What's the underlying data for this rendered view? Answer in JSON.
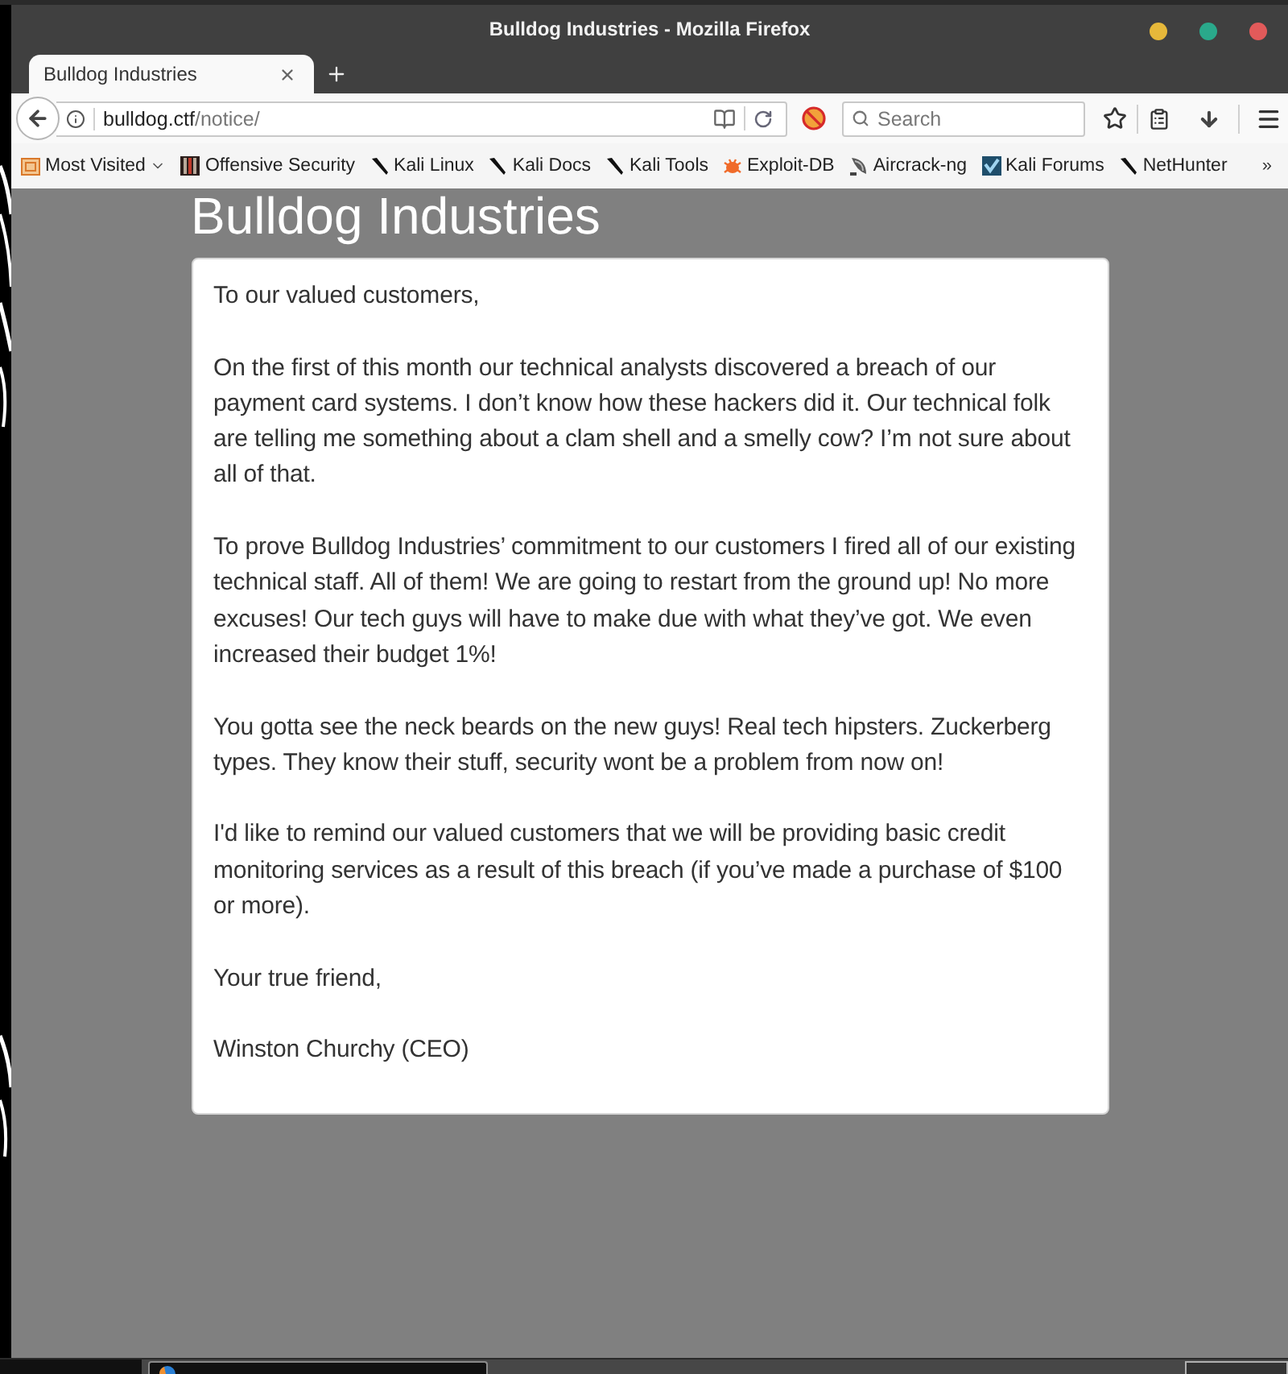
{
  "window": {
    "title": "Bulldog Industries - Mozilla Firefox",
    "controls": [
      {
        "color": "#e6b83a"
      },
      {
        "color": "#2aa98b"
      },
      {
        "color": "#e25a5a"
      }
    ]
  },
  "tabs": [
    {
      "title": "Bulldog Industries",
      "selected": true
    }
  ],
  "toolbar": {
    "url": {
      "host": "bulldog.ctf",
      "path": "/notice/"
    },
    "search": {
      "placeholder": "Search"
    }
  },
  "bookmarks": [
    {
      "kind": "folder",
      "label": "Most Visited"
    },
    {
      "kind": "offsec",
      "label": "Offensive Security"
    },
    {
      "kind": "kali",
      "label": "Kali Linux"
    },
    {
      "kind": "kali",
      "label": "Kali Docs"
    },
    {
      "kind": "kali",
      "label": "Kali Tools"
    },
    {
      "kind": "exploit",
      "label": "Exploit-DB"
    },
    {
      "kind": "aircrack",
      "label": "Aircrack-ng"
    },
    {
      "kind": "forum",
      "label": "Kali Forums"
    },
    {
      "kind": "kali",
      "label": "NetHunter"
    }
  ],
  "bookmarks_overflow": "»",
  "page": {
    "heading": "Bulldog Industries",
    "paragraphs": [
      "To our valued customers,",
      "On the first of this month our technical analysts discovered a breach of our payment card systems. I don’t know how these hackers did it. Our technical folk are telling me something about a clam shell and a smelly cow? I’m not sure about all of that.",
      "To prove Bulldog Industries’ commitment to our customers I fired all of our existing technical staff. All of them! We are going to restart from the ground up! No more excuses! Our tech guys will have to make due with what they’ve got. We even increased their budget 1%!",
      "You gotta see the neck beards on the new guys! Real tech hipsters. Zuckerberg types. They know their stuff, security wont be a problem from now on!",
      "I'd like to remind our valued customers that we will be providing basic credit monitoring services as a result of this breach (if you’ve made a purchase of $100 or more).",
      "Your true friend,",
      "Winston Churchy (CEO)"
    ]
  }
}
